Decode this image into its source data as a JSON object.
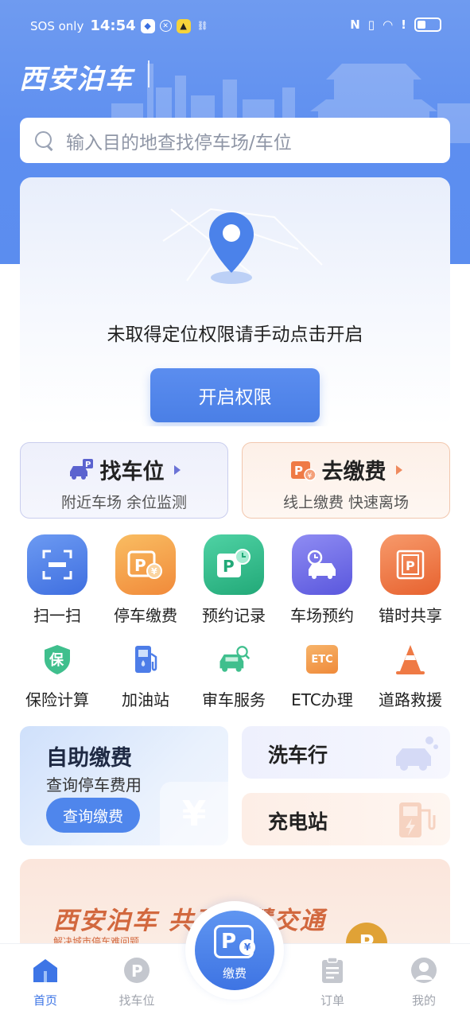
{
  "status_bar": {
    "carrier": "SOS only",
    "time": "14:54"
  },
  "header": {
    "app_title": "西安泊车"
  },
  "search": {
    "placeholder": "输入目的地查找停车场/车位"
  },
  "location_card": {
    "message": "未取得定位权限请手动点击开启",
    "button_label": "开启权限"
  },
  "features": [
    {
      "title": "找车位",
      "subtitle": "附近车场 余位监测"
    },
    {
      "title": "去缴费",
      "subtitle": "线上缴费 快速离场"
    }
  ],
  "grid_row1": [
    {
      "label": "扫一扫",
      "icon": "scan-icon",
      "color": "#4d7de8"
    },
    {
      "label": "停车缴费",
      "icon": "parking-pay-icon",
      "color": "#f4a14a"
    },
    {
      "label": "预约记录",
      "icon": "reservation-record-icon",
      "color": "#2fba8c"
    },
    {
      "label": "车场预约",
      "icon": "lot-reservation-icon",
      "color": "#6f6de6"
    },
    {
      "label": "错时共享",
      "icon": "shared-parking-icon",
      "color": "#ef7a45"
    }
  ],
  "grid_row2": [
    {
      "label": "保险计算",
      "icon": "insurance-icon",
      "glyph": "保"
    },
    {
      "label": "加油站",
      "icon": "gas-station-icon",
      "glyph": ""
    },
    {
      "label": "审车服务",
      "icon": "car-inspection-icon",
      "glyph": ""
    },
    {
      "label": "ETC办理",
      "icon": "etc-icon",
      "glyph": "ETC"
    },
    {
      "label": "道路救援",
      "icon": "road-rescue-icon",
      "glyph": ""
    }
  ],
  "services": {
    "self_pay": {
      "title": "自助缴费",
      "subtitle": "查询停车费用",
      "button": "查询缴费",
      "deco": "¥"
    },
    "car_wash": {
      "title": "洗车行"
    },
    "charging": {
      "title": "充电站"
    }
  },
  "banner": {
    "title": "西安泊车  共建智慧交通",
    "subtitle": "解决城市停车难问题"
  },
  "bottom_nav": {
    "items": [
      {
        "label": "首页"
      },
      {
        "label": "找车位"
      },
      {
        "label": "缴费"
      },
      {
        "label": "订单"
      },
      {
        "label": "我的"
      }
    ]
  }
}
